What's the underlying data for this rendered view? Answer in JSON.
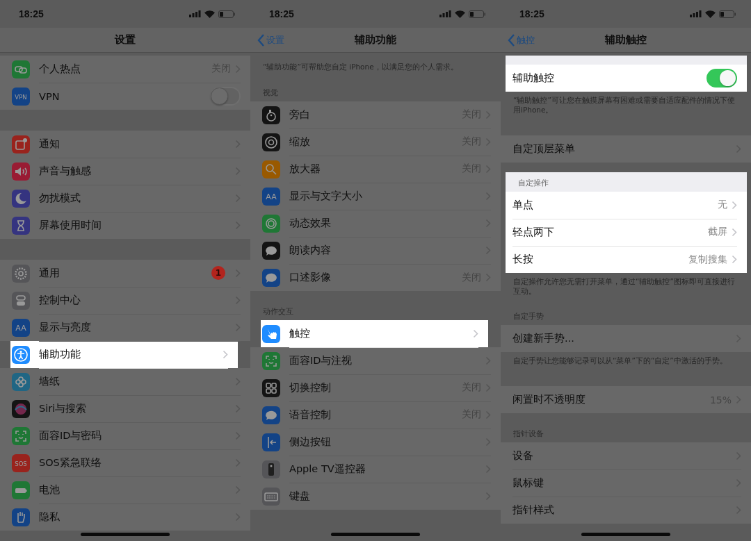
{
  "panels": [
    {
      "status_time": "18:25",
      "title": "设置",
      "groups": [
        {
          "rows": [
            {
              "kind": "hotspot",
              "label": "个人热点",
              "value": "关闭"
            },
            {
              "kind": "vpn",
              "icon_text": "VPN",
              "label": "VPN",
              "toggle": {
                "on": false
              }
            }
          ]
        },
        {
          "rows": [
            {
              "kind": "notifications",
              "label": "通知"
            },
            {
              "kind": "sounds",
              "label": "声音与触感"
            },
            {
              "kind": "dnd",
              "label": "勿扰模式"
            },
            {
              "kind": "screentime",
              "label": "屏幕使用时间"
            }
          ]
        },
        {
          "rows": [
            {
              "kind": "general",
              "label": "通用",
              "badge": "1"
            },
            {
              "kind": "control",
              "label": "控制中心"
            },
            {
              "kind": "textsize",
              "icon_text": "AA",
              "label": "显示与亮度"
            },
            {
              "kind": "accessibility",
              "label": "辅助功能",
              "highlighted": true
            },
            {
              "kind": "wallpaper",
              "label": "墙纸"
            },
            {
              "kind": "siri",
              "label": "Siri与搜索"
            },
            {
              "kind": "faceid",
              "label": "面容ID与密码"
            },
            {
              "kind": "sos",
              "icon_text": "SOS",
              "label": "SOS紧急联络"
            },
            {
              "kind": "battery",
              "label": "电池"
            },
            {
              "kind": "privacy",
              "label": "隐私"
            }
          ]
        }
      ]
    },
    {
      "status_time": "18:25",
      "back": "设置",
      "title": "辅助功能",
      "intro": "“辅助功能”可帮助您自定 iPhone，以满足您的个人需求。",
      "groups": [
        {
          "header": "视觉",
          "rows": [
            {
              "kind": "voiceover",
              "label": "旁白",
              "value": "关闭"
            },
            {
              "kind": "zoom",
              "label": "缩放",
              "value": "关闭"
            },
            {
              "kind": "magnifier",
              "label": "放大器",
              "value": "关闭"
            },
            {
              "kind": "textsize",
              "icon_text": "AA",
              "label": "显示与文字大小"
            },
            {
              "kind": "motion",
              "label": "动态效果"
            },
            {
              "kind": "spoken",
              "label": "朗读内容"
            },
            {
              "kind": "audiodesc",
              "label": "口述影像",
              "value": "关闭"
            }
          ]
        },
        {
          "header": "动作交互",
          "rows": [
            {
              "kind": "touch",
              "label": "触控",
              "highlighted": true
            },
            {
              "kind": "faceid",
              "label": "面容ID与注视"
            },
            {
              "kind": "switchctl",
              "label": "切换控制",
              "value": "关闭"
            },
            {
              "kind": "voicectl",
              "label": "语音控制",
              "value": "关闭"
            },
            {
              "kind": "sidebutton",
              "label": "侧边按钮"
            },
            {
              "kind": "remote",
              "label": "Apple TV遥控器"
            },
            {
              "kind": "keyboard",
              "label": "键盘"
            }
          ]
        }
      ]
    },
    {
      "status_time": "18:25",
      "back": "触控",
      "title": "辅助触控",
      "groups": [
        {
          "highlighted": true,
          "rows": [
            {
              "label": "辅助触控",
              "toggle": {
                "on": true
              }
            }
          ],
          "footer": "“辅助触控”可让您在触摸屏幕有困难或需要自适应配件的情况下使用iPhone。"
        },
        {
          "rows": [
            {
              "label": "自定顶层菜单"
            }
          ]
        },
        {
          "highlighted": true,
          "header": "自定操作",
          "rows": [
            {
              "label": "单点",
              "value": "无"
            },
            {
              "label": "轻点两下",
              "value": "截屏"
            },
            {
              "label": "长按",
              "value": "复制搜集"
            }
          ],
          "footer": "自定操作允许您无需打开菜单，通过“辅助触控”图标即可直接进行互动。"
        },
        {
          "header": "自定手势",
          "rows": [
            {
              "label": "创建新手势..."
            }
          ],
          "footer": "自定手势让您能够记录可以从“菜单”下的“自定”中激活的手势。"
        },
        {
          "rows": [
            {
              "label": "闲置时不透明度",
              "value": "15%"
            }
          ]
        },
        {
          "header": "指针设备",
          "rows": [
            {
              "label": "设备"
            },
            {
              "label": "鼠标键"
            },
            {
              "label": "指针样式"
            }
          ]
        }
      ]
    }
  ]
}
